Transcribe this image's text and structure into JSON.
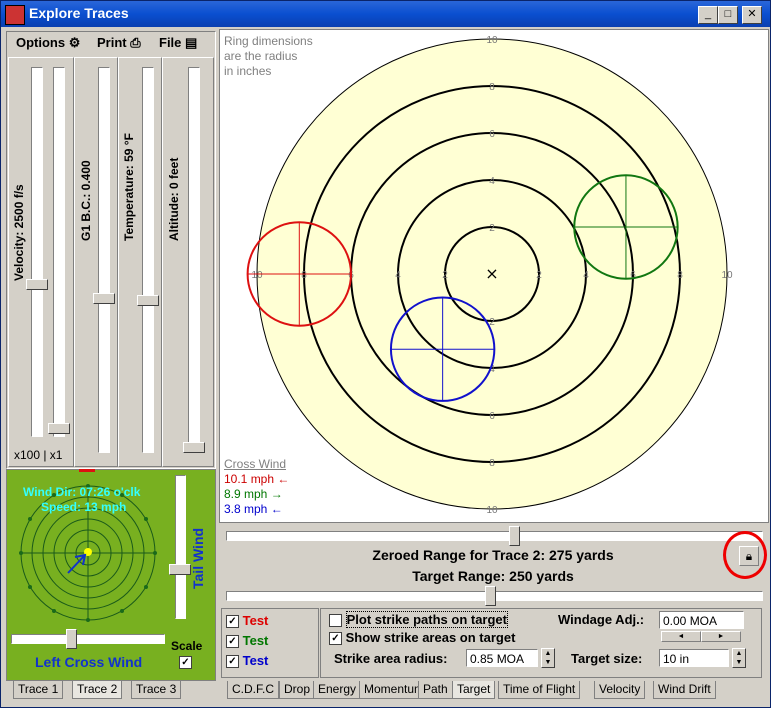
{
  "window": {
    "title": "Explore Traces",
    "min_icon": "minimize-icon",
    "max_icon": "maximize-icon",
    "close_icon": "close-icon"
  },
  "toolbar": {
    "options": "Options",
    "print": "Print",
    "file": "File"
  },
  "sliders": {
    "velocity": {
      "label": "Velocity:  2500 f/s",
      "level": 0.6
    },
    "bc": {
      "label": "G1 B.C.:  0.400",
      "level": 0.6
    },
    "temperature": {
      "label": "Temperature:  59 °F",
      "level": 0.6
    },
    "altitude": {
      "label": "Altitude:  0 feet",
      "level": 0.0
    },
    "scale_text": "x100 | x1"
  },
  "wind": {
    "dir": "Wind Dir: 07:26 o'clk",
    "speed": "Speed: 13 mph",
    "tail_label": "Tail Wind",
    "cross_label": "Left Cross Wind",
    "scale_label": "Scale",
    "scale_checked": "✓"
  },
  "target": {
    "note_line1": "Ring dimensions",
    "note_line2": "are the radius",
    "note_line3": "in inches",
    "ring_labels": [
      "2",
      "4",
      "6",
      "8",
      "10"
    ],
    "cross_wind_title": "Cross Wind",
    "cross_wind": [
      {
        "text": "10.1 mph ←",
        "color": "#cc0000"
      },
      {
        "text": "8.9 mph →",
        "color": "#007700"
      },
      {
        "text": "3.8 mph ←",
        "color": "#0000cc"
      }
    ],
    "colors": {
      "face": "#ffffd4",
      "ring": "#000000",
      "red": "#dd1111",
      "green": "#117711",
      "blue": "#1111cc"
    }
  },
  "ranges": {
    "zeroed": "Zeroed Range for Trace 2:  275 yards",
    "target": "Target Range:  250 yards",
    "lock_icon": "lock-icon"
  },
  "traces": [
    {
      "name": "Test",
      "color": "#dd0000",
      "checked": "✓"
    },
    {
      "name": "Test",
      "color": "#007700",
      "checked": "✓"
    },
    {
      "name": "Test",
      "color": "#0000cc",
      "checked": "✓"
    }
  ],
  "options": {
    "plot_paths": "Plot strike paths on target",
    "show_areas": "Show strike areas on target",
    "show_areas_checked": "✓",
    "strike_radius_label": "Strike area radius:",
    "strike_radius_value": "0.85 MOA",
    "windage_label": "Windage Adj.:",
    "windage_value": "0.00 MOA",
    "target_size_label": "Target size:",
    "target_size_value": "10 in"
  },
  "left_tabs": [
    "Trace 1",
    "Trace 2",
    "Trace 3"
  ],
  "bottom_tabs": [
    "C.D.F.C",
    "Drop",
    "Energy",
    "Momentum",
    "Path",
    "Target",
    "Time of Flight",
    "Velocity",
    "Wind Drift"
  ]
}
